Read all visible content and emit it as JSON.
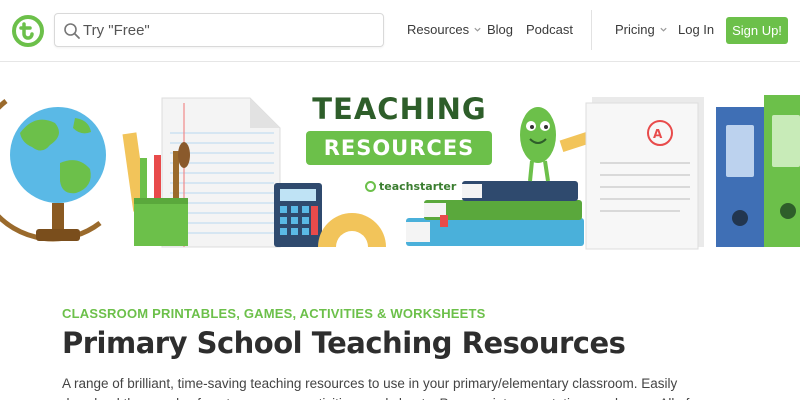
{
  "header": {
    "search_placeholder": "Try \"Free\"",
    "nav": {
      "resources": "Resources",
      "blog": "Blog",
      "podcast": "Podcast",
      "pricing": "Pricing",
      "login": "Log In",
      "signup": "Sign Up!"
    }
  },
  "banner": {
    "title": "TEACHING",
    "subtitle": "RESOURCES",
    "brand": "teachstarter"
  },
  "content": {
    "eyebrow": "CLASSROOM PRINTABLES, GAMES, ACTIVITIES & WORKSHEETS",
    "title": "Primary School Teaching Resources",
    "description": "A range of brilliant, time-saving teaching resources to use in your primary/elementary classroom. Easily download thousands of posters, games, activities, worksheets, Powerpoint presentations and more. All of"
  },
  "colors": {
    "brand_green": "#6cc04a",
    "dark_green": "#2e5e2a"
  },
  "icons": [
    "logo-icon",
    "search-icon",
    "chevron-down-icon",
    "globe-icon",
    "pencil-cup-icon",
    "calculator-icon",
    "protractor-icon",
    "books-icon",
    "mascot-icon",
    "paper-icon",
    "binder-icon"
  ]
}
